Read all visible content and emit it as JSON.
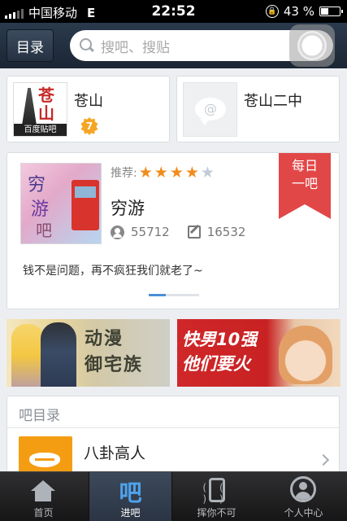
{
  "status_bar": {
    "carrier": "中国移动",
    "network": "E",
    "time": "22:52",
    "battery": "43 %",
    "battery_level": 0.43
  },
  "nav": {
    "menu_label": "目录",
    "search_placeholder": "搜吧、搜贴"
  },
  "forums": [
    {
      "name": "苍山",
      "logo_text": "苍山",
      "logo_caption": "百度贴吧",
      "level": "7",
      "icon": "forum-logo"
    },
    {
      "name": "苍山二中",
      "icon": "chat-bubble-icon"
    }
  ],
  "recommend": {
    "label": "推荐:",
    "rating": 4,
    "rating_max": 5,
    "ribbon_line1": "每日",
    "ribbon_line2": "一吧",
    "image_text": [
      "穷",
      "游",
      "吧"
    ],
    "name": "穷游",
    "members": "55712",
    "posts": "16532",
    "description": "钱不是问题，再不疯狂我们就老了~",
    "page_index": 1,
    "page_count": 3
  },
  "banners": [
    {
      "line1": "动漫",
      "line2": "御宅族"
    },
    {
      "line1": "快男10强",
      "line2": "他们要火"
    }
  ],
  "directory": {
    "title": "吧目录",
    "items": [
      {
        "name": "八卦高人",
        "icon": "lips-icon"
      }
    ]
  },
  "tabs": [
    {
      "label": "首页",
      "icon": "home-icon",
      "active": false
    },
    {
      "label": "进吧",
      "icon_text": "吧",
      "active": true
    },
    {
      "label": "挥你不可",
      "icon": "phone-shake-icon",
      "active": false
    },
    {
      "label": "个人中心",
      "icon": "person-icon",
      "active": false
    }
  ],
  "colors": {
    "nav_bg": "#1b2634",
    "accent_blue": "#4ea3ee",
    "star_on": "#f08d1d",
    "ribbon_red": "#e24747",
    "badge_orange": "#f5a623"
  }
}
